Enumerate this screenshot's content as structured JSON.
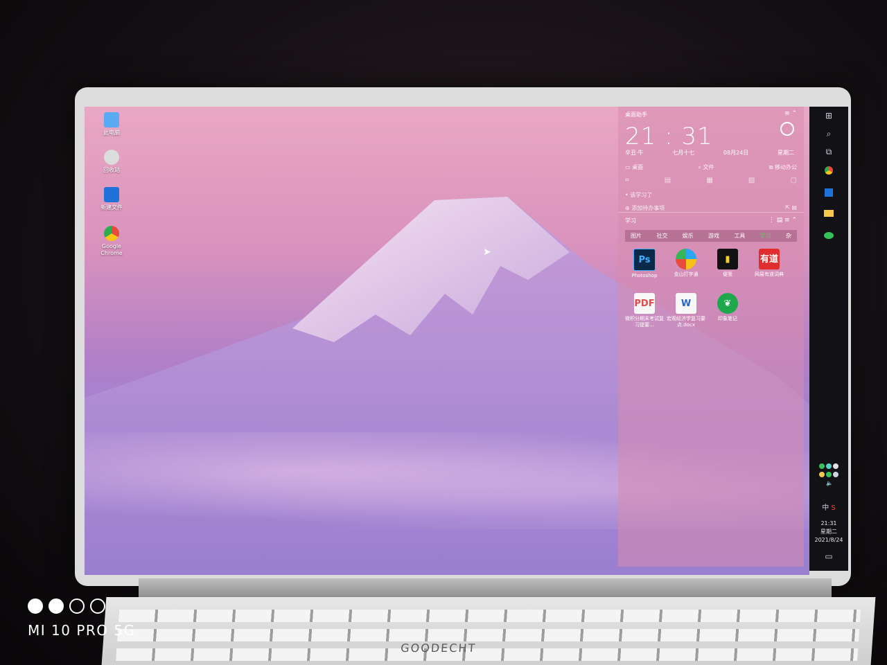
{
  "desktop_icons": [
    {
      "label": "此电脑"
    },
    {
      "label": "回收站"
    },
    {
      "label": "新建文件"
    },
    {
      "label": "Google Chrome"
    }
  ],
  "panel": {
    "title": "桌面助手",
    "controls": "≡ ⌃",
    "clock": "21 : 31",
    "lunar_year": "辛丑·牛",
    "lunar_day": "七月十七",
    "date": "08月24日",
    "weekday": "星期二",
    "tools": {
      "desktop": "桌面",
      "file": "文件",
      "office": "移动办公"
    },
    "todo_item": "• 该学习了",
    "add_todo": "⊕ 添加待办事项",
    "section_title": "学习",
    "tabs": [
      "图片",
      "社交",
      "娱乐",
      "游戏",
      "工具",
      "学习",
      "杂"
    ],
    "active_tab": "学习",
    "apps": [
      {
        "label": "Photoshop",
        "icon": "Ps"
      },
      {
        "label": "金山打字通",
        "icon": ""
      },
      {
        "label": "便笺",
        "icon": "▮"
      },
      {
        "label": "网易有道词典",
        "icon": "有道"
      },
      {
        "label": "微积分期末考试复习提要...",
        "icon": "PDF"
      },
      {
        "label": "宏观经济学复习要点.docx",
        "icon": "W"
      },
      {
        "label": "印象笔记",
        "icon": "❦"
      }
    ]
  },
  "taskbar": {
    "ime": "中",
    "time": "21:31",
    "weekday": "星期二",
    "date": "2021/8/24"
  },
  "keyboard_brand": "GOODECHT",
  "watermark": {
    "brand": "MI 10 PRO 5G"
  },
  "colors": {
    "accent_green": "#6ac36a",
    "taskbar": "#111116"
  }
}
